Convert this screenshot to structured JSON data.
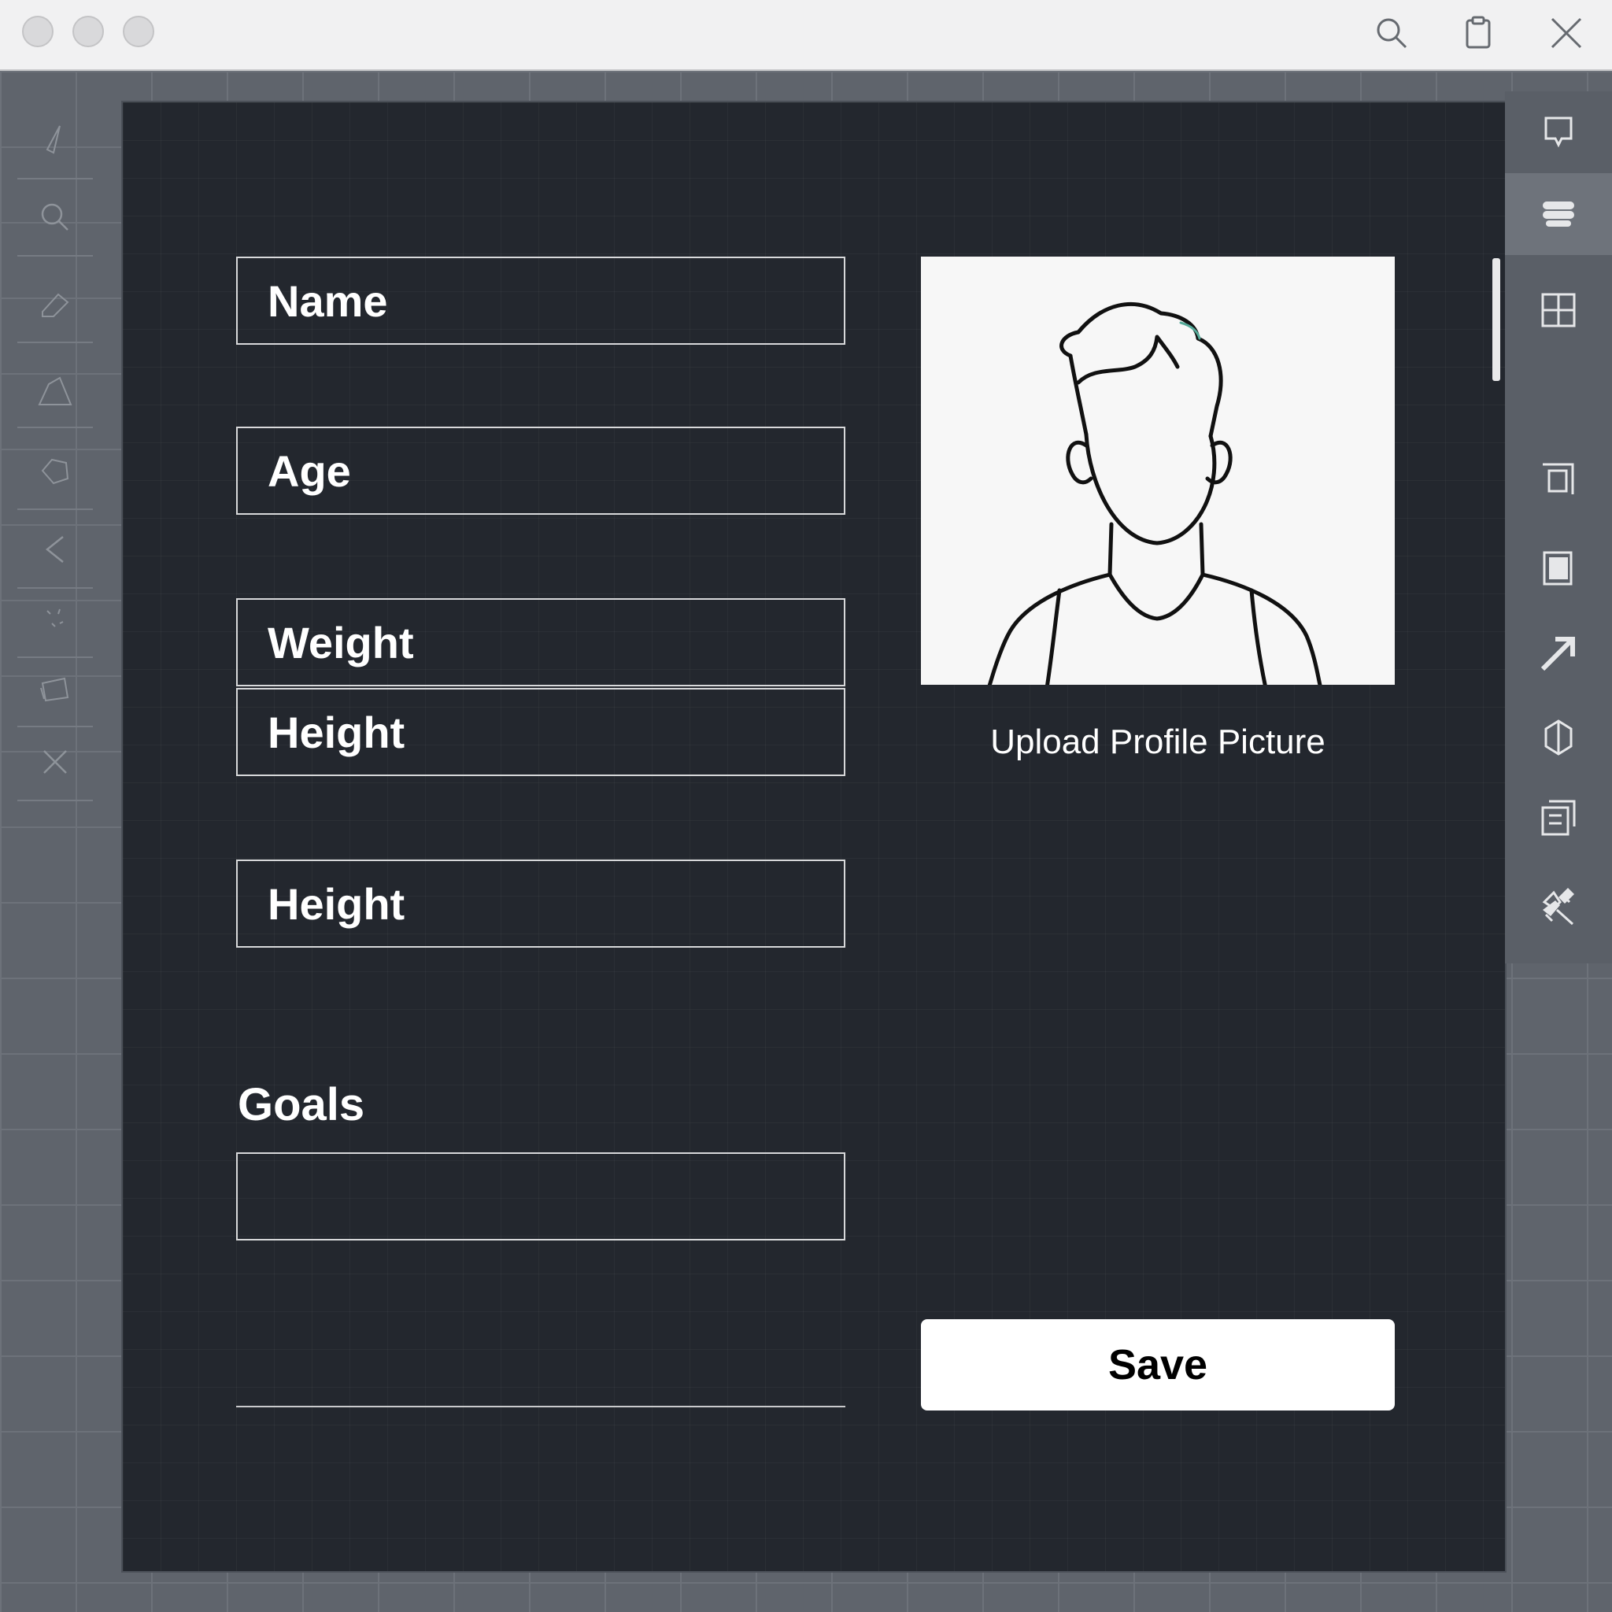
{
  "titlebar": {
    "window_controls": [
      "close",
      "minimize",
      "zoom"
    ],
    "icons": [
      "search-icon",
      "clipboard-icon",
      "close-icon"
    ]
  },
  "left_toolbar": {
    "icons": [
      "pen-icon",
      "zoom-icon",
      "eraser-icon",
      "shape-icon",
      "polygon-icon",
      "back-arrow-icon",
      "sparkle-icon",
      "layers-icon",
      "close-icon"
    ]
  },
  "right_toolbar": {
    "icons": [
      "comment-icon",
      "stack-icon",
      "layout-icon",
      "frame-icon",
      "page-icon",
      "arrow-icon",
      "cube-icon",
      "building-icon",
      "magic-icon",
      "tool-icon"
    ],
    "active_index": 1
  },
  "form": {
    "fields": [
      {
        "label": "Name"
      },
      {
        "label": "Age"
      },
      {
        "label": "Weight"
      },
      {
        "label": "Height"
      },
      {
        "label": "Height"
      }
    ],
    "goals_label": "Goals",
    "goals_value": ""
  },
  "profile": {
    "upload_label": "Upload Profile Picture"
  },
  "actions": {
    "save_label": "Save"
  },
  "colors": {
    "canvas_bg": "#23272e",
    "workspace_bg": "#5f646c",
    "button_bg": "#ffffff"
  }
}
